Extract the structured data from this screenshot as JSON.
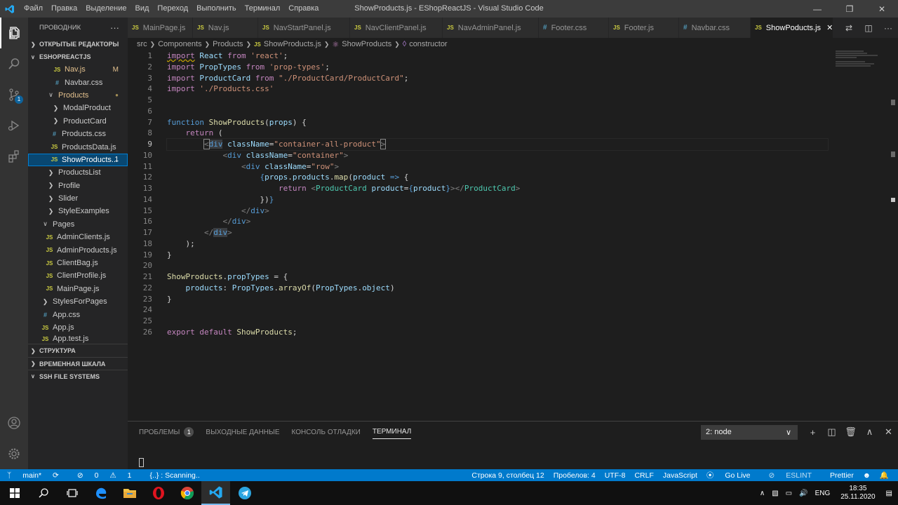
{
  "window": {
    "title": "ShowProducts.js - EShopReactJS - Visual Studio Code",
    "menu": [
      "Файл",
      "Правка",
      "Выделение",
      "Вид",
      "Переход",
      "Выполнить",
      "Терминал",
      "Справка"
    ]
  },
  "activity": {
    "source_control_badge": "1"
  },
  "sidebar": {
    "header": "ПРОВОДНИК",
    "more": "···",
    "open_editors": "ОТКРЫТЫЕ РЕДАКТОРЫ",
    "project": "ESHOPREACTJS",
    "items": [
      {
        "label": "Nav.js",
        "icon": "JS",
        "flag": "M"
      },
      {
        "label": "Navbar.css",
        "icon": "#"
      },
      {
        "label": "Products",
        "icon": "chevron-down",
        "flag": "●"
      },
      {
        "label": "ModalProduct",
        "icon": "chevron-right"
      },
      {
        "label": "ProductCard",
        "icon": "chevron-right"
      },
      {
        "label": "Products.css",
        "icon": "#"
      },
      {
        "label": "ProductsData.js",
        "icon": "JS"
      },
      {
        "label": "ShowProducts...",
        "icon": "JS",
        "flag": "1"
      },
      {
        "label": "ProductsList",
        "icon": "chevron-right"
      },
      {
        "label": "Profile",
        "icon": "chevron-right"
      },
      {
        "label": "Slider",
        "icon": "chevron-right"
      },
      {
        "label": "StyleExamples",
        "icon": "chevron-right"
      },
      {
        "label": "Pages",
        "icon": "chevron-down"
      },
      {
        "label": "AdminClients.js",
        "icon": "JS"
      },
      {
        "label": "AdminProducts.js",
        "icon": "JS"
      },
      {
        "label": "ClientBag.js",
        "icon": "JS"
      },
      {
        "label": "ClientProfile.js",
        "icon": "JS"
      },
      {
        "label": "MainPage.js",
        "icon": "JS"
      },
      {
        "label": "StylesForPages",
        "icon": "chevron-right"
      },
      {
        "label": "App.css",
        "icon": "#"
      },
      {
        "label": "App.js",
        "icon": "JS"
      },
      {
        "label": "App.test.js",
        "icon": "JS"
      }
    ],
    "sections": [
      "СТРУКТУРА",
      "ВРЕМЕННАЯ ШКАЛА",
      "SSH FILE SYSTEMS"
    ]
  },
  "tabs": [
    {
      "label": "MainPage.js",
      "icon": "JS"
    },
    {
      "label": "Nav.js",
      "icon": "JS"
    },
    {
      "label": "NavStartPanel.js",
      "icon": "JS"
    },
    {
      "label": "NavClientPanel.js",
      "icon": "JS"
    },
    {
      "label": "NavAdminPanel.js",
      "icon": "JS"
    },
    {
      "label": "Footer.css",
      "icon": "#"
    },
    {
      "label": "Footer.js",
      "icon": "JS"
    },
    {
      "label": "Navbar.css",
      "icon": "#"
    },
    {
      "label": "ShowPoducts.js",
      "icon": "JS",
      "active": true
    }
  ],
  "breadcrumb": [
    "src",
    "Components",
    "Products",
    "ShowProducts.js",
    "ShowProducts",
    "constructor"
  ],
  "editor": {
    "line_numbers": [
      "1",
      "2",
      "3",
      "4",
      "5",
      "6",
      "7",
      "8",
      "9",
      "10",
      "11",
      "12",
      "13",
      "14",
      "15",
      "16",
      "17",
      "18",
      "19",
      "20",
      "21",
      "22",
      "23",
      "24",
      "25",
      "26"
    ],
    "current_line": 9
  },
  "panel": {
    "tabs": [
      "ПРОБЛЕМЫ",
      "ВЫХОДНЫЕ ДАННЫЕ",
      "КОНСОЛЬ ОТЛАДКИ",
      "ТЕРМИНАЛ"
    ],
    "problems_count": "1",
    "terminal_select": "2: node"
  },
  "statusbar": {
    "branch": "main*",
    "errors": "0",
    "warnings": "1",
    "scanning": "{..} : Scanning..",
    "position": "Строка 9, столбец 12",
    "spaces": "Пробелов: 4",
    "encoding": "UTF-8",
    "eol": "CRLF",
    "language": "JavaScript",
    "golive": "Go Live",
    "eslint": "ESLINT",
    "prettier": "Prettier"
  },
  "taskbar": {
    "lang": "ENG",
    "time": "18:35",
    "date": "25.11.2020"
  },
  "colors": {
    "accent": "#007acc",
    "editor_bg": "#1e1e1e",
    "sidebar_bg": "#252526"
  }
}
